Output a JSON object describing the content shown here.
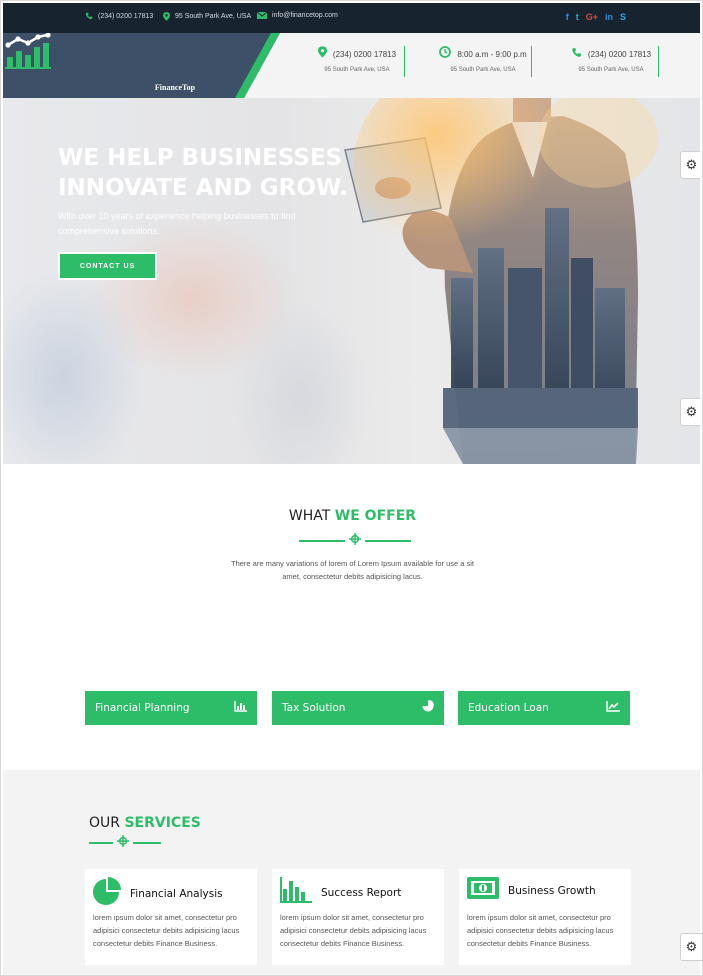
{
  "topbar": {
    "phone": "(234) 0200 17813",
    "address": "95 South Park Ave, USA",
    "email": "info@financetop.com",
    "social": [
      {
        "icon": "facebook-icon",
        "glyph": "f",
        "color": "#3b8fd9"
      },
      {
        "icon": "twitter-icon",
        "glyph": "t",
        "color": "#35a9e0"
      },
      {
        "icon": "google-plus-icon",
        "glyph": "G+",
        "color": "#e04a3a"
      },
      {
        "icon": "linkedin-icon",
        "glyph": "in",
        "color": "#2b8fd1"
      },
      {
        "icon": "skype-icon",
        "glyph": "S",
        "color": "#2fa9e3"
      }
    ]
  },
  "header": {
    "logo_text": "FinanceTop",
    "info": [
      {
        "icon": "map-pin-icon",
        "main": "(234) 0200 17813",
        "sub": "95 South Park Ave, USA"
      },
      {
        "icon": "clock-icon",
        "main": "8:00 a.m - 9:00 p.m",
        "sub": "95 South Park Ave, USA"
      },
      {
        "icon": "phone-icon",
        "main": "(234) 0200 17813",
        "sub": "95 South Park Ave, USA"
      }
    ]
  },
  "hero": {
    "title_line1": "WE HELP BUSINESSES",
    "title_line2": "INNOVATE AND GROW.",
    "subtitle": "With over 10 years of experience helping businesses to find comprehensive solutions.",
    "cta": "CONTACT US"
  },
  "offer": {
    "title_plain": "WHAT ",
    "title_accent": "WE OFFER",
    "description_line1": "There are many variations of lorem of Lorem Ipsum available for use a sit",
    "description_line2": "amet, consectetur debits adipisicing lacus.",
    "features": [
      {
        "label": "Financial Planning",
        "icon": "bar-chart-icon"
      },
      {
        "label": "Tax Solution",
        "icon": "pie-chart-icon"
      },
      {
        "label": "Education Loan",
        "icon": "line-chart-icon"
      }
    ]
  },
  "services": {
    "title_plain": "OUR ",
    "title_accent": "SERVICES",
    "items": [
      {
        "name": "Financial Analysis",
        "icon": "pie-chart-icon",
        "text": "lorem ipsum dolor sit amet, consectetur pro adipisici consectetur debits adipisicing lacus consectetur debits Finance Business."
      },
      {
        "name": "Success Report",
        "icon": "bar-chart-icon",
        "text": "lorem ipsum dolor sit amet, consectetur pro adipisici consectetur debits adipisicing lacus consectetur debits Finance Business."
      },
      {
        "name": "Business Growth",
        "icon": "money-icon",
        "text": "lorem ipsum dolor sit amet, consectetur pro adipisici consectetur debits adipisicing lacus consectetur debits Finance Business."
      }
    ]
  },
  "colors": {
    "accent": "#2dbd68",
    "dark": "#182330",
    "logo_panel": "#3d5068"
  }
}
